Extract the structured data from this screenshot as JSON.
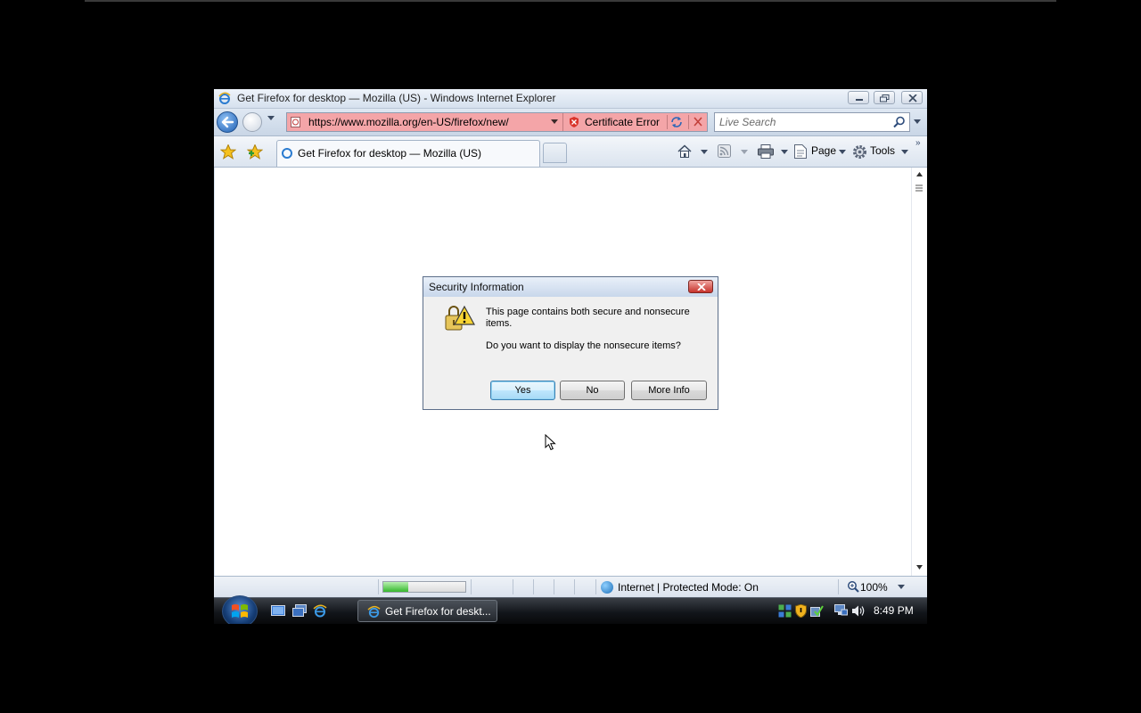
{
  "window": {
    "title": "Get Firefox for desktop — Mozilla (US) - Windows Internet Explorer"
  },
  "navbar": {
    "url": "https://www.mozilla.org/en-US/firefox/new/",
    "cert_error_label": "Certificate Error",
    "search_placeholder": "Live Search"
  },
  "tabs": [
    {
      "label": "Get Firefox for desktop — Mozilla (US)",
      "active": true
    }
  ],
  "command_bar": {
    "page_label": "Page",
    "tools_label": "Tools"
  },
  "dialog": {
    "title": "Security Information",
    "message_1": "This page contains both secure and nonsecure items.",
    "message_2": "Do you want to display the nonsecure items?",
    "buttons": {
      "yes": "Yes",
      "no": "No",
      "more_info": "More Info"
    },
    "default_button": "yes"
  },
  "statusbar": {
    "progress_fraction": 0.3,
    "zone_text": "Internet | Protected Mode: On",
    "zoom": "100%"
  },
  "taskbar": {
    "task_label": "Get Firefox for deskt...",
    "clock": "8:49 PM"
  },
  "colors": {
    "address_bar_error": "#f4a5a8",
    "progress_green": "#35b82d"
  }
}
